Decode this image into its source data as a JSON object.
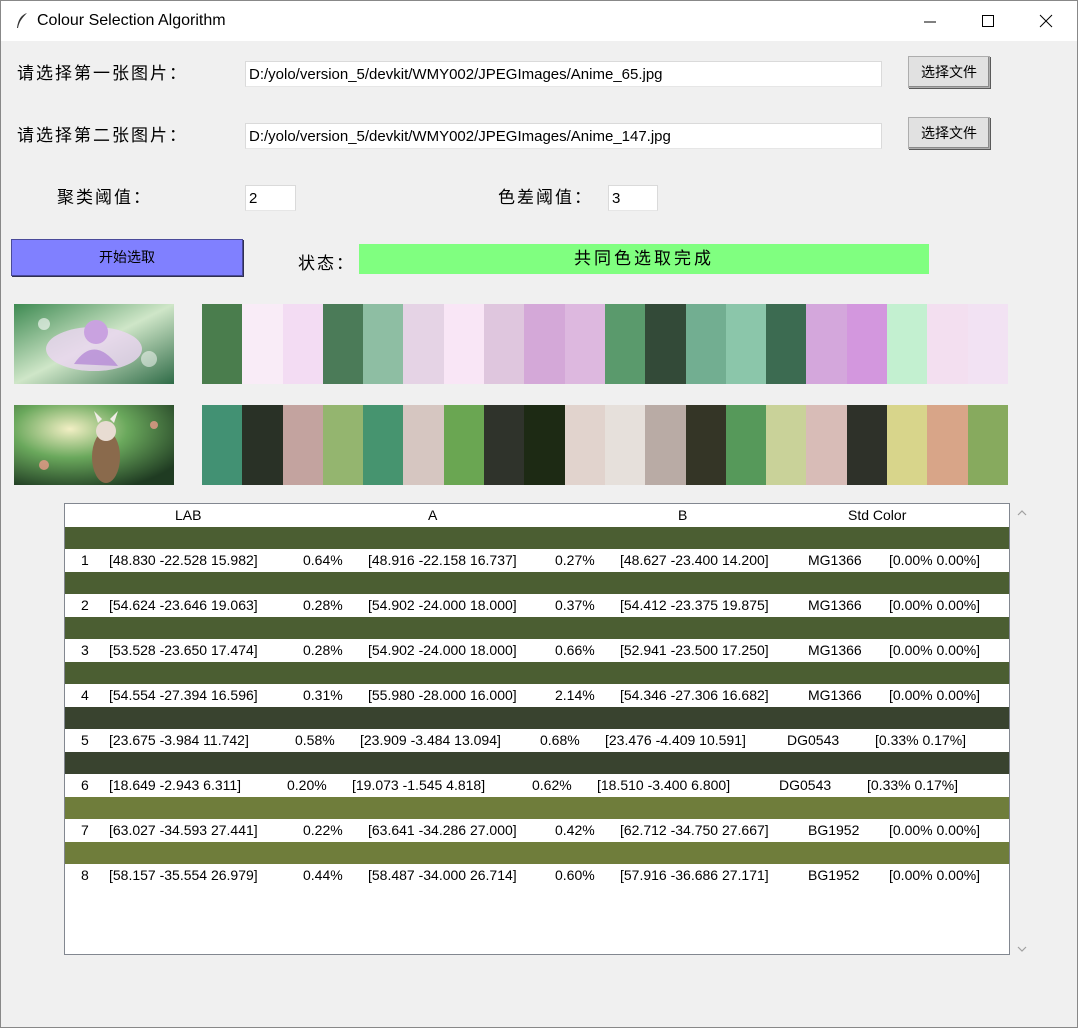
{
  "window": {
    "title": "Colour Selection Algorithm"
  },
  "file1": {
    "label": "请选择第一张图片：",
    "path": "D:/yolo/version_5/devkit/WMY002/JPEGImages/Anime_65.jpg",
    "button": "选择文件"
  },
  "file2": {
    "label": "请选择第二张图片：",
    "path": "D:/yolo/version_5/devkit/WMY002/JPEGImages/Anime_147.jpg",
    "button": "选择文件"
  },
  "cluster": {
    "label": "聚类阈值：",
    "value": "2"
  },
  "diff": {
    "label": "色差阈值：",
    "value": "3"
  },
  "start_button": "开始选取",
  "status": {
    "label": "状态：",
    "text": "共同色选取完成",
    "color": "#80ff80"
  },
  "swatches1": [
    "#4a7d4d",
    "#f9ecf7",
    "#f3dcf3",
    "#4b7b58",
    "#8ebea3",
    "#e5d3e5",
    "#f9e6f6",
    "#dfc6de",
    "#d4a8d8",
    "#ddb8df",
    "#5a9a6c",
    "#334a38",
    "#72ae91",
    "#8bc6aa",
    "#3c6b51",
    "#d4a7dc",
    "#d397de",
    "#c3f0d0",
    "#f3dff0",
    "#f2e2f3"
  ],
  "swatches2": [
    "#429173",
    "#293126",
    "#c3a39f",
    "#94b56f",
    "#46946f",
    "#d6c6c1",
    "#6aa652",
    "#2f332b",
    "#1d2a14",
    "#e1d3cd",
    "#e6e0db",
    "#b9aba5",
    "#343526",
    "#56995a",
    "#c9d299",
    "#d8bcb7",
    "#2e3129",
    "#d8d58b",
    "#d8a588",
    "#87aa5e"
  ],
  "table": {
    "headers": [
      "LAB",
      "A",
      "B",
      "Std Color"
    ],
    "rows": [
      {
        "n": "1",
        "lab": "[48.830 -22.528 15.982]",
        "p1": "0.64%",
        "a": "[48.916 -22.158 16.737]",
        "p2": "0.27%",
        "b": "[48.627 -23.400 14.200]",
        "std": "MG1366",
        "dev": "[0.00% 0.00%]",
        "color": "#4b5e32"
      },
      {
        "n": "2",
        "lab": "[54.624 -23.646 19.063]",
        "p1": "0.28%",
        "a": "[54.902 -24.000 18.000]",
        "p2": "0.37%",
        "b": "[54.412 -23.375 19.875]",
        "std": "MG1366",
        "dev": "[0.00% 0.00%]",
        "color": "#4b5e32"
      },
      {
        "n": "3",
        "lab": "[53.528 -23.650 17.474]",
        "p1": "0.28%",
        "a": "[54.902 -24.000 18.000]",
        "p2": "0.66%",
        "b": "[52.941 -23.500 17.250]",
        "std": "MG1366",
        "dev": "[0.00% 0.00%]",
        "color": "#4b5e32"
      },
      {
        "n": "4",
        "lab": "[54.554 -27.394 16.596]",
        "p1": "0.31%",
        "a": "[55.980 -28.000 16.000]",
        "p2": "2.14%",
        "b": "[54.346 -27.306 16.682]",
        "std": "MG1366",
        "dev": "[0.00% 0.00%]",
        "color": "#4b5e32"
      },
      {
        "n": "5",
        "lab": "[23.675 -3.984 11.742]",
        "p1": "0.58%",
        "a": "[23.909 -3.484 13.094]",
        "p2": "0.68%",
        "b": "[23.476 -4.409 10.591]",
        "std": "DG0543",
        "dev": "[0.33% 0.17%]",
        "color": "#39432f"
      },
      {
        "n": "6",
        "lab": "[18.649 -2.943 6.311]",
        "p1": "0.20%",
        "a": "[19.073 -1.545 4.818]",
        "p2": "0.62%",
        "b": "[18.510 -3.400 6.800]",
        "std": "DG0543",
        "dev": "[0.33% 0.17%]",
        "color": "#39432f"
      },
      {
        "n": "7",
        "lab": "[63.027 -34.593 27.441]",
        "p1": "0.22%",
        "a": "[63.641 -34.286 27.000]",
        "p2": "0.42%",
        "b": "[62.712 -34.750 27.667]",
        "std": "BG1952",
        "dev": "[0.00% 0.00%]",
        "color": "#6f7d3b"
      },
      {
        "n": "8",
        "lab": "[58.157 -35.554 26.979]",
        "p1": "0.44%",
        "a": "[58.487 -34.000 26.714]",
        "p2": "0.60%",
        "b": "[57.916 -36.686 27.171]",
        "std": "BG1952",
        "dev": "[0.00% 0.00%]",
        "color": "#6f7d3b"
      }
    ]
  }
}
